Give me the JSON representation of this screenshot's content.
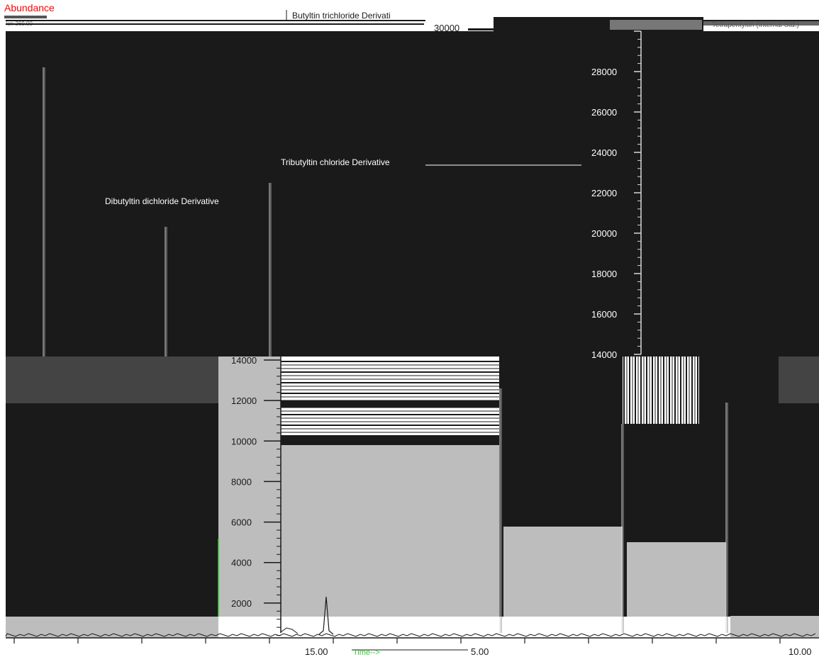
{
  "header": {
    "y_title": "Abundance",
    "y_subtitle": "Ion 269.00",
    "series_fragment": "Butyltin trichloride Derivati",
    "inset_top_label": "30000",
    "right_legend": "Tetrapentyltin (Internal Std.)",
    "x_axis_label": "Time-->"
  },
  "colors": {
    "dark_panel": "#1a1a1a",
    "gray_panel": "#bdbdbd",
    "mid_gray": "#444444",
    "trace": "#d8d8d8",
    "title_red": "#ff0000",
    "accent_green": "#2bd42b",
    "label_white": "#ffffff"
  },
  "chart_data": {
    "type": "line",
    "x_tick_labels": [
      "15.00",
      "5.00",
      "10.00"
    ],
    "upper_y_ticks": [
      14000,
      16000,
      18000,
      20000,
      22000,
      24000,
      26000,
      28000,
      30000
    ],
    "lower_y_ticks": [
      2000,
      4000,
      6000,
      8000,
      10000,
      12000,
      14000
    ],
    "annotations": [
      {
        "text": "Dibutyltin dichloride Derivative"
      },
      {
        "text": "Tributyltin chloride Derivative"
      }
    ],
    "grid": false
  }
}
